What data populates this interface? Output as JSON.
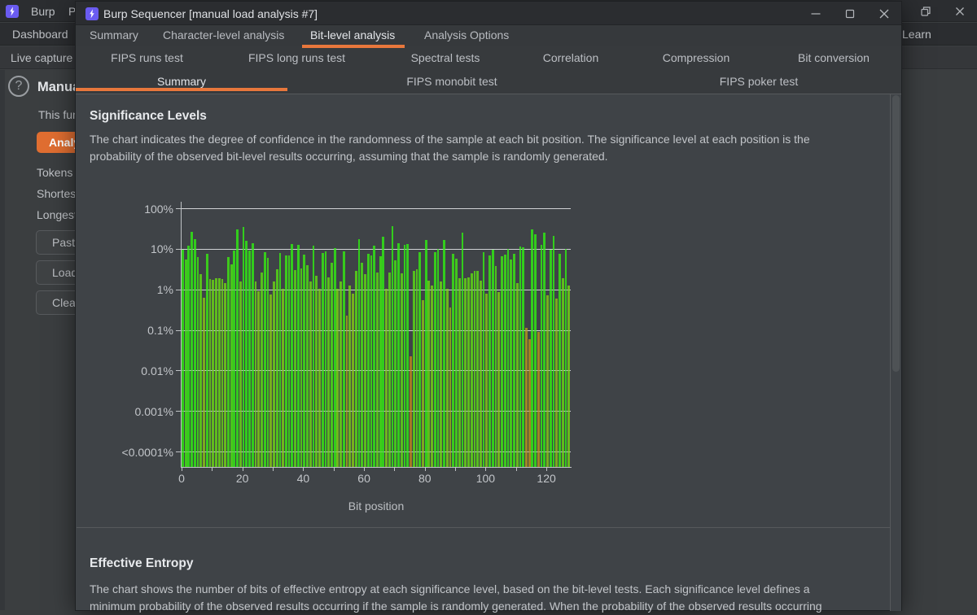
{
  "colors": {
    "accent_orange": "#E8773C",
    "analyze_button_orange": "#E06E31",
    "burp_icon_purple": "#6A5BF0",
    "bar_green_bright": "#32CD1C",
    "bar_amber_low": "#A87224"
  },
  "background_window": {
    "menu": {
      "app": "Burp",
      "items": [
        "Project"
      ]
    },
    "tabs": {
      "left": "Dashboard",
      "right": "Learn"
    },
    "subtab": "Live capture",
    "panel": {
      "heading": "Manual load",
      "help_icon": "?",
      "description": "This function allows you to load Sequencer with a sample of tokens that you have already obtained.",
      "analyze_button": "Analyze now",
      "stats": [
        "Tokens loaded:",
        "Shortest:",
        "Longest:"
      ],
      "buttons": [
        "Paste",
        "Load ...",
        "Clear"
      ]
    }
  },
  "dialog": {
    "title": "Burp Sequencer [manual load analysis #7]",
    "window_controls": [
      "minimize",
      "maximize",
      "close"
    ],
    "tabs": [
      {
        "label": "Summary",
        "active": false
      },
      {
        "label": "Character-level analysis",
        "active": false
      },
      {
        "label": "Bit-level analysis",
        "active": true
      },
      {
        "label": "Analysis Options",
        "active": false
      }
    ],
    "subtab_rows": [
      [
        {
          "label": "FIPS runs test",
          "active": false
        },
        {
          "label": "FIPS long runs test",
          "active": false
        },
        {
          "label": "Spectral tests",
          "active": false
        },
        {
          "label": "Correlation",
          "active": false
        },
        {
          "label": "Compression",
          "active": false
        },
        {
          "label": "Bit conversion",
          "active": false
        }
      ],
      [
        {
          "label": "Summary",
          "active": true
        },
        {
          "label": "FIPS monobit test",
          "active": false
        },
        {
          "label": "FIPS poker test",
          "active": false
        }
      ]
    ],
    "sections": [
      {
        "heading": "Significance Levels",
        "description": "The chart indicates the degree of confidence in the randomness of the sample at each bit position. The significance level at each position is the probability of the observed bit-level results occurring, assuming that the sample is randomly generated."
      },
      {
        "heading": "Effective Entropy",
        "description": "The chart shows the number of bits of effective entropy at each significance level, based on the bit-level tests. Each significance level defines a minimum probability of the observed results occurring if the sample is randomly generated. When the probability of the observed results occurring"
      }
    ]
  },
  "chart_data": {
    "type": "bar",
    "title": "Significance Levels",
    "xlabel": "Bit position",
    "ylabel": "",
    "y_scale": "log",
    "y_tick_labels": [
      "100%",
      "10%",
      "1%",
      "0.1%",
      "0.01%",
      "0.001%",
      "<0.0001%"
    ],
    "x_tick_labels": [
      "0",
      "20",
      "40",
      "60",
      "80",
      "100",
      "120"
    ],
    "x_minor_tick_every": 10,
    "x": "bit positions 0-127",
    "values_percent": [
      9.5,
      5.5,
      12,
      26,
      17,
      6.2,
      2.4,
      0.62,
      7.5,
      1.8,
      1.7,
      1.9,
      1.85,
      1.8,
      1.45,
      6.3,
      4.2,
      8.9,
      30,
      1.6,
      35,
      16,
      9,
      14,
      1.6,
      0.9,
      2.6,
      8.3,
      6.1,
      0.75,
      1.6,
      3.2,
      7.9,
      1.05,
      7.0,
      7.0,
      13,
      3.0,
      12.3,
      3.3,
      7.2,
      4.0,
      1.6,
      11.7,
      2.2,
      1.05,
      8.0,
      8.5,
      2.0,
      4.6,
      10.4,
      1.05,
      1.6,
      8.7,
      0.22,
      1.26,
      0.8,
      2.9,
      17.7,
      4.6,
      2.4,
      7.7,
      7.0,
      11.7,
      2.6,
      6.5,
      20,
      1.05,
      2.6,
      36,
      5.3,
      13.5,
      2.45,
      12.5,
      13.4,
      0.022,
      2.9,
      3.1,
      8.1,
      0.55,
      16.3,
      1.63,
      1.25,
      8.3,
      9.9,
      1.55,
      16.3,
      1.05,
      0.35,
      7.4,
      5.7,
      1.9,
      25,
      1.9,
      2.0,
      2.5,
      2.9,
      2.8,
      1.63,
      8.3,
      0.8,
      7.0,
      9.7,
      3.7,
      0.85,
      6.5,
      7.2,
      10,
      5.4,
      7.5,
      1.4,
      11.5,
      11,
      0.11,
      0.06,
      30,
      23,
      0.09,
      12.6,
      25,
      0.7,
      9.7,
      21,
      0.58,
      7.6,
      1.85,
      10,
      1.25
    ],
    "bar_color_scale": [
      {
        "significance_at_most_decades_below_100": 1,
        "color": "#32CD1C"
      },
      {
        "significance_at_most_decades_below_100": 2,
        "color": "#71B51E"
      },
      {
        "significance_at_most_decades_below_100": 3,
        "color": "#A08623"
      },
      {
        "significance_at_most_decades_below_100": 4,
        "color": "#A87224"
      }
    ],
    "grid": true,
    "legend": false
  }
}
